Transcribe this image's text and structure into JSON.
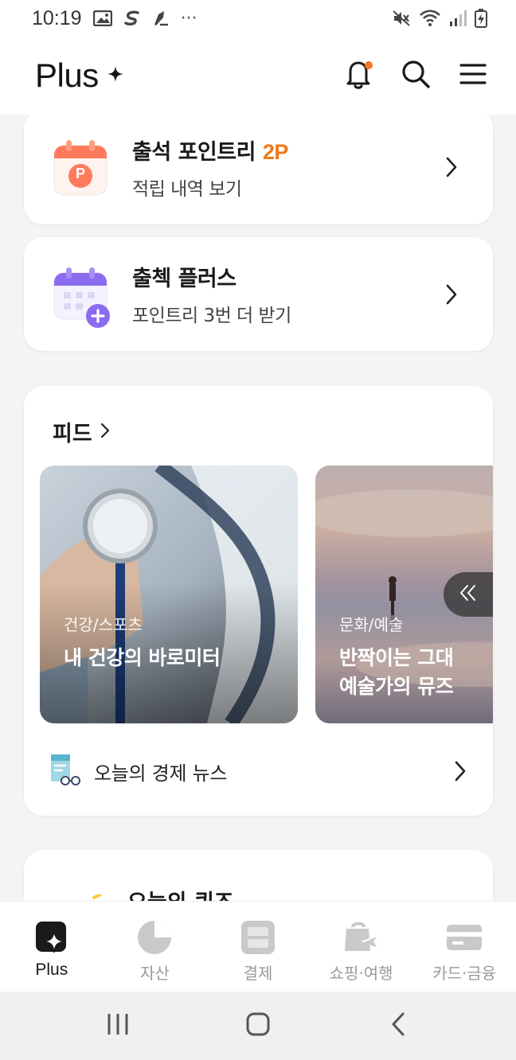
{
  "status_bar": {
    "time": "10:19",
    "more": "···"
  },
  "header": {
    "logo_text": "Plus"
  },
  "attendance": {
    "title_prefix": "출석 포인트리 ",
    "points": "2P",
    "subtitle": "적립 내역 보기",
    "icon_letter": "P"
  },
  "attendance_plus": {
    "title": "출첵 플러스",
    "subtitle": "포인트리 3번 더 받기"
  },
  "feed": {
    "title": "피드",
    "cards": [
      {
        "category": "건강/스포츠",
        "title_lines": [
          "내 건강의 바로미터"
        ]
      },
      {
        "category": "문화/예술",
        "title_lines": [
          "반짝이는 그대",
          "예술가의 뮤즈"
        ]
      }
    ],
    "news_label": "오늘의 경제 뉴스"
  },
  "quiz": {
    "title": "오늘의 퀴즈"
  },
  "bottom_nav": [
    {
      "label": "Plus",
      "icon": "plus-sparkle-icon",
      "active": true
    },
    {
      "label": "자산",
      "icon": "pie-chart-icon",
      "active": false
    },
    {
      "label": "결제",
      "icon": "scan-icon",
      "active": false
    },
    {
      "label": "쇼핑·여행",
      "icon": "shopping-bag-plane-icon",
      "active": false
    },
    {
      "label": "카드·금융",
      "icon": "card-icon",
      "active": false
    }
  ],
  "colors": {
    "accent_orange": "#f07a1a",
    "notif_dot": "#f47621",
    "calendar_orange": "#ff7a5c",
    "calendar_purple": "#8b6cf0"
  }
}
